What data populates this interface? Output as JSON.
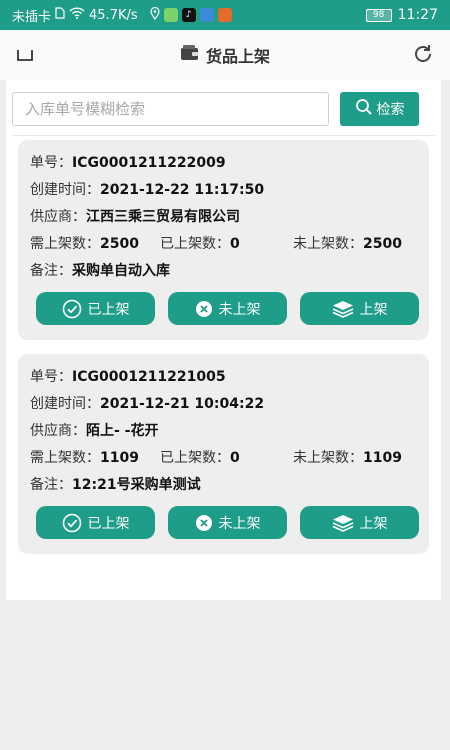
{
  "statusbar": {
    "carrier": "未插卡",
    "speed": "45.7K/s",
    "battery": "98",
    "time": "11:27"
  },
  "header": {
    "title": "货品上架"
  },
  "search": {
    "placeholder": "入库单号模糊检索",
    "button_label": "检索"
  },
  "labels": {
    "order_no": "单号：",
    "created": "创建时间：",
    "supplier": "供应商：",
    "need": "需上架数：",
    "done": "已上架数：",
    "pending": "未上架数：",
    "remark": "备注："
  },
  "actions": {
    "shelved": "已上架",
    "unshelved": "未上架",
    "shelve": "上架"
  },
  "orders": [
    {
      "order_no": "ICG0001211222009",
      "created": "2021-12-22 11:17:50",
      "supplier": "江西三乘三贸易有限公司",
      "need": "2500",
      "done": "0",
      "pending": "2500",
      "remark": "采购单自动入库"
    },
    {
      "order_no": "ICG0001211221005",
      "created": "2021-12-21 10:04:22",
      "supplier": "陌上- -花开",
      "need": "1109",
      "done": "0",
      "pending": "1109",
      "remark": "12:21号采购单测试"
    }
  ],
  "colors": {
    "accent": "#1e9d88",
    "card_bg": "#eeeeee",
    "page_bg": "#eeeeee"
  }
}
